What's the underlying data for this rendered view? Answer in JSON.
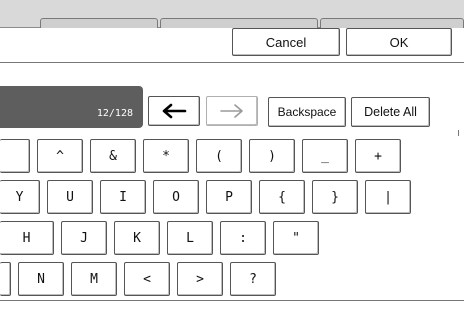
{
  "dialog": {
    "cancel_label": "Cancel",
    "ok_label": "OK"
  },
  "input": {
    "counter": "12/128"
  },
  "editing": {
    "left_arrow_icon": "arrow-left-icon",
    "right_arrow_icon": "arrow-right-icon",
    "backspace_label": "Backspace",
    "delete_all_label": "Delete All"
  },
  "keyboard": {
    "row1": [
      "^",
      "&",
      "*",
      "(",
      ")",
      "_",
      "+"
    ],
    "row2": [
      "Y",
      "U",
      "I",
      "O",
      "P",
      "{",
      "}",
      "|"
    ],
    "row3": [
      "H",
      "J",
      "K",
      "L",
      ":",
      "\""
    ],
    "row4": [
      "N",
      "M",
      "<",
      ">",
      "?"
    ]
  }
}
